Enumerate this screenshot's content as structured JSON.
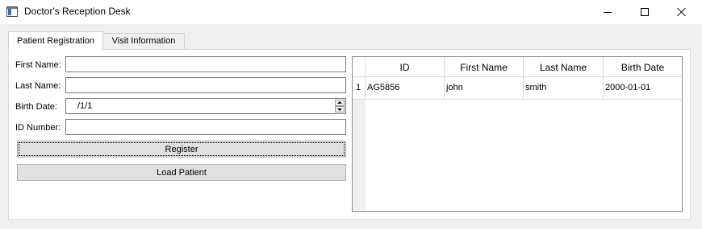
{
  "window": {
    "title": "Doctor's Reception Desk",
    "icon": "app-window-icon",
    "controls": [
      "minimize-icon",
      "maximize-icon",
      "close-icon"
    ]
  },
  "tabs": [
    {
      "label": "Patient Registration",
      "active": true
    },
    {
      "label": "Visit Information",
      "active": false
    }
  ],
  "form": {
    "first_name_label": "First Name:",
    "first_name_value": "",
    "last_name_label": "Last Name:",
    "last_name_value": "",
    "birth_date_label": "Birth Date:",
    "birth_date_value": "/1/1",
    "id_number_label": "ID Number:",
    "id_number_value": ""
  },
  "buttons": {
    "register": "Register",
    "load_patient": "Load Patient"
  },
  "table": {
    "columns": [
      "ID",
      "First Name",
      "Last Name",
      "Birth Date"
    ],
    "rows": [
      {
        "row_number": "1",
        "cells": [
          "AG5856",
          "john",
          "smith",
          "2000-01-01"
        ]
      }
    ]
  }
}
